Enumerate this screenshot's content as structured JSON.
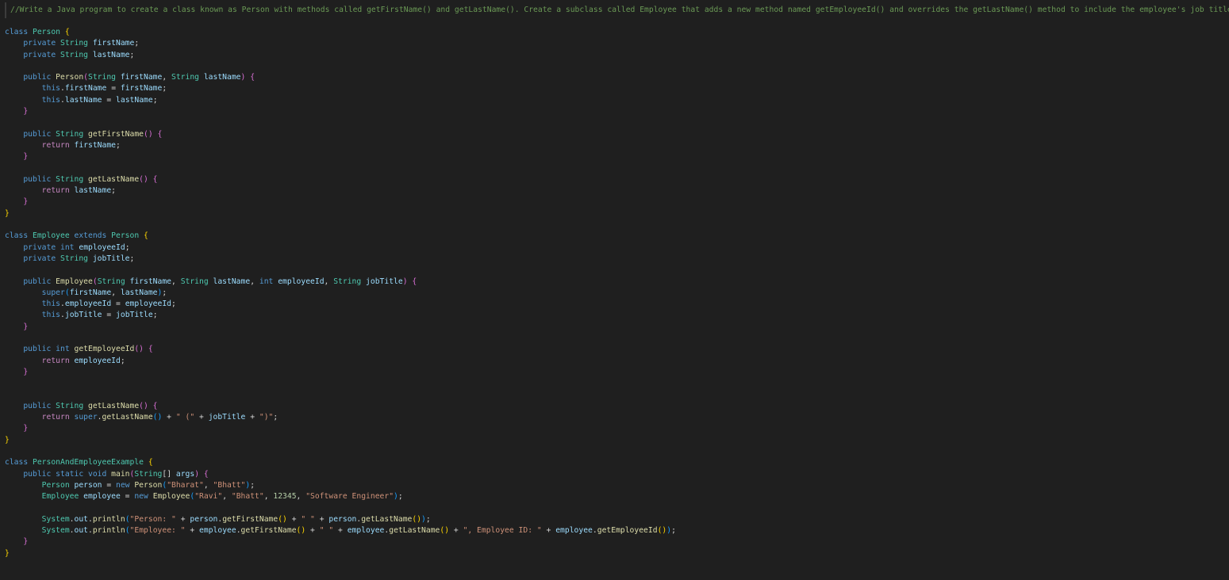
{
  "editor": {
    "comment": "//Write a Java program to create a class known as Person with methods called getFirstName() and getLastName(). Create a subclass called Employee that adds a new method named getEmployeeId() and overrides the getLastName() method to include the employee's job title",
    "lines": [
      [
        [
          "keyword",
          "class "
        ],
        [
          "type",
          "Person "
        ],
        [
          "brace1",
          "{"
        ]
      ],
      [
        [
          "plain",
          "    "
        ],
        [
          "keyword",
          "private "
        ],
        [
          "type",
          "String "
        ],
        [
          "var",
          "firstName"
        ],
        [
          "plain",
          ";"
        ]
      ],
      [
        [
          "plain",
          "    "
        ],
        [
          "keyword",
          "private "
        ],
        [
          "type",
          "String "
        ],
        [
          "var",
          "lastName"
        ],
        [
          "plain",
          ";"
        ]
      ],
      [],
      [
        [
          "plain",
          "    "
        ],
        [
          "keyword",
          "public "
        ],
        [
          "func",
          "Person"
        ],
        [
          "brace2",
          "("
        ],
        [
          "type",
          "String "
        ],
        [
          "var",
          "firstName"
        ],
        [
          "plain",
          ", "
        ],
        [
          "type",
          "String "
        ],
        [
          "var",
          "lastName"
        ],
        [
          "brace2",
          ")"
        ],
        [
          "plain",
          " "
        ],
        [
          "brace2",
          "{"
        ]
      ],
      [
        [
          "plain",
          "        "
        ],
        [
          "keyword",
          "this"
        ],
        [
          "plain",
          "."
        ],
        [
          "var",
          "firstName"
        ],
        [
          "plain",
          " = "
        ],
        [
          "var",
          "firstName"
        ],
        [
          "plain",
          ";"
        ]
      ],
      [
        [
          "plain",
          "        "
        ],
        [
          "keyword",
          "this"
        ],
        [
          "plain",
          "."
        ],
        [
          "var",
          "lastName"
        ],
        [
          "plain",
          " = "
        ],
        [
          "var",
          "lastName"
        ],
        [
          "plain",
          ";"
        ]
      ],
      [
        [
          "plain",
          "    "
        ],
        [
          "brace2",
          "}"
        ]
      ],
      [],
      [
        [
          "plain",
          "    "
        ],
        [
          "keyword",
          "public "
        ],
        [
          "type",
          "String "
        ],
        [
          "func",
          "getFirstName"
        ],
        [
          "brace2",
          "()"
        ],
        [
          "plain",
          " "
        ],
        [
          "brace2",
          "{"
        ]
      ],
      [
        [
          "plain",
          "        "
        ],
        [
          "control",
          "return "
        ],
        [
          "var",
          "firstName"
        ],
        [
          "plain",
          ";"
        ]
      ],
      [
        [
          "plain",
          "    "
        ],
        [
          "brace2",
          "}"
        ]
      ],
      [],
      [
        [
          "plain",
          "    "
        ],
        [
          "keyword",
          "public "
        ],
        [
          "type",
          "String "
        ],
        [
          "func",
          "getLastName"
        ],
        [
          "brace2",
          "()"
        ],
        [
          "plain",
          " "
        ],
        [
          "brace2",
          "{"
        ]
      ],
      [
        [
          "plain",
          "        "
        ],
        [
          "control",
          "return "
        ],
        [
          "var",
          "lastName"
        ],
        [
          "plain",
          ";"
        ]
      ],
      [
        [
          "plain",
          "    "
        ],
        [
          "brace2",
          "}"
        ]
      ],
      [
        [
          "brace1",
          "}"
        ]
      ],
      [],
      [
        [
          "keyword",
          "class "
        ],
        [
          "type",
          "Employee "
        ],
        [
          "keyword",
          "extends "
        ],
        [
          "type",
          "Person "
        ],
        [
          "brace1",
          "{"
        ]
      ],
      [
        [
          "plain",
          "    "
        ],
        [
          "keyword",
          "private "
        ],
        [
          "keyword",
          "int "
        ],
        [
          "var",
          "employeeId"
        ],
        [
          "plain",
          ";"
        ]
      ],
      [
        [
          "plain",
          "    "
        ],
        [
          "keyword",
          "private "
        ],
        [
          "type",
          "String "
        ],
        [
          "var",
          "jobTitle"
        ],
        [
          "plain",
          ";"
        ]
      ],
      [],
      [
        [
          "plain",
          "    "
        ],
        [
          "keyword",
          "public "
        ],
        [
          "func",
          "Employee"
        ],
        [
          "brace2",
          "("
        ],
        [
          "type",
          "String "
        ],
        [
          "var",
          "firstName"
        ],
        [
          "plain",
          ", "
        ],
        [
          "type",
          "String "
        ],
        [
          "var",
          "lastName"
        ],
        [
          "plain",
          ", "
        ],
        [
          "keyword",
          "int "
        ],
        [
          "var",
          "employeeId"
        ],
        [
          "plain",
          ", "
        ],
        [
          "type",
          "String "
        ],
        [
          "var",
          "jobTitle"
        ],
        [
          "brace2",
          ")"
        ],
        [
          "plain",
          " "
        ],
        [
          "brace2",
          "{"
        ]
      ],
      [
        [
          "plain",
          "        "
        ],
        [
          "keyword",
          "super"
        ],
        [
          "brace3",
          "("
        ],
        [
          "var",
          "firstName"
        ],
        [
          "plain",
          ", "
        ],
        [
          "var",
          "lastName"
        ],
        [
          "brace3",
          ")"
        ],
        [
          "plain",
          ";"
        ]
      ],
      [
        [
          "plain",
          "        "
        ],
        [
          "keyword",
          "this"
        ],
        [
          "plain",
          "."
        ],
        [
          "var",
          "employeeId"
        ],
        [
          "plain",
          " = "
        ],
        [
          "var",
          "employeeId"
        ],
        [
          "plain",
          ";"
        ]
      ],
      [
        [
          "plain",
          "        "
        ],
        [
          "keyword",
          "this"
        ],
        [
          "plain",
          "."
        ],
        [
          "var",
          "jobTitle"
        ],
        [
          "plain",
          " = "
        ],
        [
          "var",
          "jobTitle"
        ],
        [
          "plain",
          ";"
        ]
      ],
      [
        [
          "plain",
          "    "
        ],
        [
          "brace2",
          "}"
        ]
      ],
      [],
      [
        [
          "plain",
          "    "
        ],
        [
          "keyword",
          "public "
        ],
        [
          "keyword",
          "int "
        ],
        [
          "func",
          "getEmployeeId"
        ],
        [
          "brace2",
          "()"
        ],
        [
          "plain",
          " "
        ],
        [
          "brace2",
          "{"
        ]
      ],
      [
        [
          "plain",
          "        "
        ],
        [
          "control",
          "return "
        ],
        [
          "var",
          "employeeId"
        ],
        [
          "plain",
          ";"
        ]
      ],
      [
        [
          "plain",
          "    "
        ],
        [
          "brace2",
          "}"
        ]
      ],
      [],
      [],
      [
        [
          "plain",
          "    "
        ],
        [
          "keyword",
          "public "
        ],
        [
          "type",
          "String "
        ],
        [
          "func",
          "getLastName"
        ],
        [
          "brace2",
          "()"
        ],
        [
          "plain",
          " "
        ],
        [
          "brace2",
          "{"
        ]
      ],
      [
        [
          "plain",
          "        "
        ],
        [
          "control",
          "return "
        ],
        [
          "keyword",
          "super"
        ],
        [
          "plain",
          "."
        ],
        [
          "func",
          "getLastName"
        ],
        [
          "brace3",
          "()"
        ],
        [
          "plain",
          " + "
        ],
        [
          "string",
          "\" (\""
        ],
        [
          "plain",
          " + "
        ],
        [
          "var",
          "jobTitle"
        ],
        [
          "plain",
          " + "
        ],
        [
          "string",
          "\")\""
        ],
        [
          "plain",
          ";"
        ]
      ],
      [
        [
          "plain",
          "    "
        ],
        [
          "brace2",
          "}"
        ]
      ],
      [
        [
          "brace1",
          "}"
        ]
      ],
      [],
      [
        [
          "keyword",
          "class "
        ],
        [
          "type",
          "PersonAndEmployeeExample "
        ],
        [
          "brace1",
          "{"
        ]
      ],
      [
        [
          "plain",
          "    "
        ],
        [
          "keyword",
          "public "
        ],
        [
          "keyword",
          "static "
        ],
        [
          "keyword",
          "void "
        ],
        [
          "func",
          "main"
        ],
        [
          "brace2",
          "("
        ],
        [
          "type",
          "String"
        ],
        [
          "plain",
          "[] "
        ],
        [
          "var",
          "args"
        ],
        [
          "brace2",
          ")"
        ],
        [
          "plain",
          " "
        ],
        [
          "brace2",
          "{"
        ]
      ],
      [
        [
          "plain",
          "        "
        ],
        [
          "type",
          "Person "
        ],
        [
          "var",
          "person"
        ],
        [
          "plain",
          " = "
        ],
        [
          "keyword",
          "new "
        ],
        [
          "func",
          "Person"
        ],
        [
          "brace3",
          "("
        ],
        [
          "string",
          "\"Bharat\""
        ],
        [
          "plain",
          ", "
        ],
        [
          "string",
          "\"Bhatt\""
        ],
        [
          "brace3",
          ")"
        ],
        [
          "plain",
          ";"
        ]
      ],
      [
        [
          "plain",
          "        "
        ],
        [
          "type",
          "Employee "
        ],
        [
          "var",
          "employee"
        ],
        [
          "plain",
          " = "
        ],
        [
          "keyword",
          "new "
        ],
        [
          "func",
          "Employee"
        ],
        [
          "brace3",
          "("
        ],
        [
          "string",
          "\"Ravi\""
        ],
        [
          "plain",
          ", "
        ],
        [
          "string",
          "\"Bhatt\""
        ],
        [
          "plain",
          ", "
        ],
        [
          "number",
          "12345"
        ],
        [
          "plain",
          ", "
        ],
        [
          "string",
          "\"Software Engineer\""
        ],
        [
          "brace3",
          ")"
        ],
        [
          "plain",
          ";"
        ]
      ],
      [],
      [
        [
          "plain",
          "        "
        ],
        [
          "type",
          "System"
        ],
        [
          "plain",
          "."
        ],
        [
          "var",
          "out"
        ],
        [
          "plain",
          "."
        ],
        [
          "func",
          "println"
        ],
        [
          "brace3",
          "("
        ],
        [
          "string",
          "\"Person: \""
        ],
        [
          "plain",
          " + "
        ],
        [
          "var",
          "person"
        ],
        [
          "plain",
          "."
        ],
        [
          "func",
          "getFirstName"
        ],
        [
          "brace1",
          "()"
        ],
        [
          "plain",
          " + "
        ],
        [
          "string",
          "\" \""
        ],
        [
          "plain",
          " + "
        ],
        [
          "var",
          "person"
        ],
        [
          "plain",
          "."
        ],
        [
          "func",
          "getLastName"
        ],
        [
          "brace1",
          "()"
        ],
        [
          "brace3",
          ")"
        ],
        [
          "plain",
          ";"
        ]
      ],
      [
        [
          "plain",
          "        "
        ],
        [
          "type",
          "System"
        ],
        [
          "plain",
          "."
        ],
        [
          "var",
          "out"
        ],
        [
          "plain",
          "."
        ],
        [
          "func",
          "println"
        ],
        [
          "brace3",
          "("
        ],
        [
          "string",
          "\"Employee: \""
        ],
        [
          "plain",
          " + "
        ],
        [
          "var",
          "employee"
        ],
        [
          "plain",
          "."
        ],
        [
          "func",
          "getFirstName"
        ],
        [
          "brace1",
          "()"
        ],
        [
          "plain",
          " + "
        ],
        [
          "string",
          "\" \""
        ],
        [
          "plain",
          " + "
        ],
        [
          "var",
          "employee"
        ],
        [
          "plain",
          "."
        ],
        [
          "func",
          "getLastName"
        ],
        [
          "brace1",
          "()"
        ],
        [
          "plain",
          " + "
        ],
        [
          "string",
          "\", Employee ID: \""
        ],
        [
          "plain",
          " + "
        ],
        [
          "var",
          "employee"
        ],
        [
          "plain",
          "."
        ],
        [
          "func",
          "getEmployeeId"
        ],
        [
          "brace1",
          "()"
        ],
        [
          "brace3",
          ")"
        ],
        [
          "plain",
          ";"
        ]
      ],
      [
        [
          "plain",
          "    "
        ],
        [
          "brace2",
          "}"
        ]
      ],
      [
        [
          "brace1",
          "}"
        ]
      ]
    ]
  }
}
